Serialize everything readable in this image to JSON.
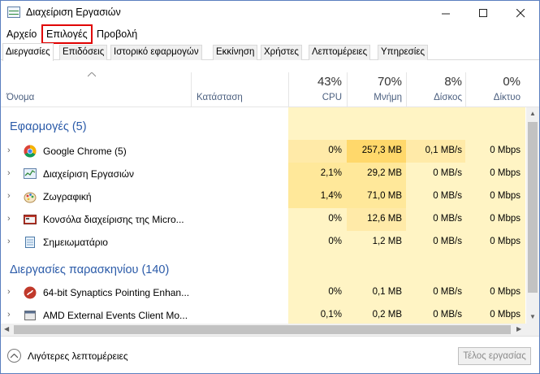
{
  "window": {
    "title": "Διαχείριση Εργασιών"
  },
  "menu": {
    "file": "Αρχείο",
    "options": "Επιλογές",
    "view": "Προβολή"
  },
  "tabs": [
    "Διεργασίες",
    "Επιδόσεις",
    "Ιστορικό εφαρμογών",
    "Εκκίνηση",
    "Χρήστες",
    "Λεπτομέρειες",
    "Υπηρεσίες"
  ],
  "columns": {
    "name": "Όνομα",
    "status": "Κατάσταση",
    "cpu": {
      "pct": "43%",
      "label": "CPU"
    },
    "memory": {
      "pct": "70%",
      "label": "Μνήμη"
    },
    "disk": {
      "pct": "8%",
      "label": "Δίσκος"
    },
    "network": {
      "pct": "0%",
      "label": "Δίκτυο"
    }
  },
  "groups": {
    "apps": "Εφαρμογές (5)",
    "background": "Διεργασίες παρασκηνίου (140)"
  },
  "apps": [
    {
      "name": "Google Chrome (5)",
      "cpu": "0%",
      "mem": "257,3 MB",
      "disk": "0,1 MB/s",
      "net": "0 Mbps",
      "icon": "chrome-icon"
    },
    {
      "name": "Διαχείριση Εργασιών",
      "cpu": "2,1%",
      "mem": "29,2 MB",
      "disk": "0 MB/s",
      "net": "0 Mbps",
      "icon": "task-manager-icon"
    },
    {
      "name": "Ζωγραφική",
      "cpu": "1,4%",
      "mem": "71,0 MB",
      "disk": "0 MB/s",
      "net": "0 Mbps",
      "icon": "paint-icon"
    },
    {
      "name": "Κονσόλα διαχείρισης της Micro...",
      "cpu": "0%",
      "mem": "12,6 MB",
      "disk": "0 MB/s",
      "net": "0 Mbps",
      "icon": "mmc-icon"
    },
    {
      "name": "Σημειωματάριο",
      "cpu": "0%",
      "mem": "1,2 MB",
      "disk": "0 MB/s",
      "net": "0 Mbps",
      "icon": "notepad-icon"
    }
  ],
  "background": [
    {
      "name": "64-bit Synaptics Pointing Enhan...",
      "cpu": "0%",
      "mem": "0,1 MB",
      "disk": "0 MB/s",
      "net": "0 Mbps",
      "icon": "synaptics-icon"
    },
    {
      "name": "AMD External Events Client Mo...",
      "cpu": "0,1%",
      "mem": "0,2 MB",
      "disk": "0 MB/s",
      "net": "0 Mbps",
      "icon": "service-icon"
    }
  ],
  "footer": {
    "less_details": "Λιγότερες λεπτομέρειες",
    "end_task": "Τέλος εργασίας"
  },
  "colors": {
    "heat_light": "#fff4c4",
    "heat_medium": "#ffe89a",
    "heat_strong": "#ffd86b",
    "group_title": "#2a5aa8",
    "highlight": "#e00000"
  }
}
